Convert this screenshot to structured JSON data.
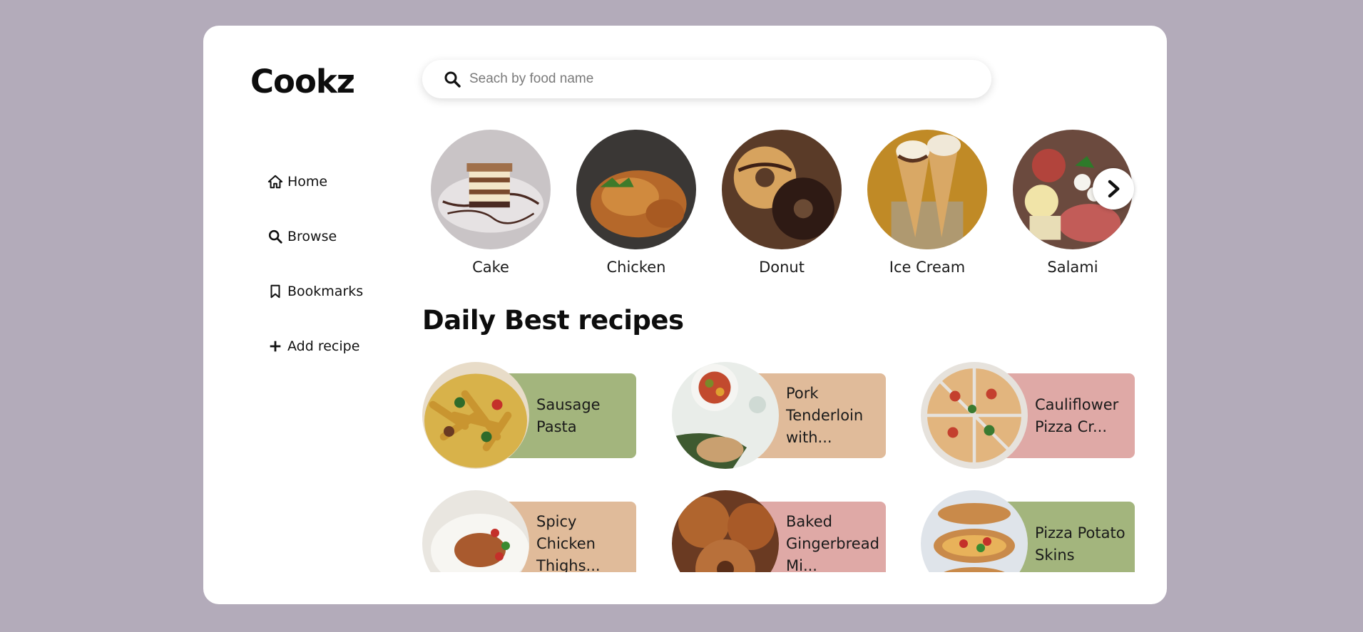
{
  "app": {
    "logo": "Cookz"
  },
  "search": {
    "placeholder": "Seach by food name",
    "value": ""
  },
  "nav": {
    "items": [
      {
        "label": "Home",
        "icon": "home-icon"
      },
      {
        "label": "Browse",
        "icon": "search-icon"
      },
      {
        "label": "Bookmarks",
        "icon": "bookmark-icon"
      },
      {
        "label": "Add recipe",
        "icon": "plus-icon"
      }
    ]
  },
  "categories": [
    {
      "label": "Cake"
    },
    {
      "label": "Chicken"
    },
    {
      "label": "Donut"
    },
    {
      "label": "Ice Cream"
    },
    {
      "label": "Salami"
    }
  ],
  "section": {
    "title": "Daily Best recipes"
  },
  "recipes": [
    {
      "name": "Sausage Pasta",
      "color": "#a3b57d"
    },
    {
      "name": "Pork Tenderloin with...",
      "color": "#e0bb9a"
    },
    {
      "name": "Cauliflower Pizza Cr...",
      "color": "#dfa9a6"
    },
    {
      "name": "Spicy Chicken Thighs...",
      "color": "#e0bb9a"
    },
    {
      "name": "Baked Gingerbread Mi...",
      "color": "#dfa9a6"
    },
    {
      "name": "Pizza Potato Skins",
      "color": "#a3b57d"
    }
  ],
  "colors": {
    "background": "#b3abba",
    "card_green": "#a3b57d",
    "card_tan": "#e0bb9a",
    "card_pink": "#dfa9a6"
  },
  "icons": {
    "next": "chevron-right-icon",
    "search": "search-icon"
  }
}
